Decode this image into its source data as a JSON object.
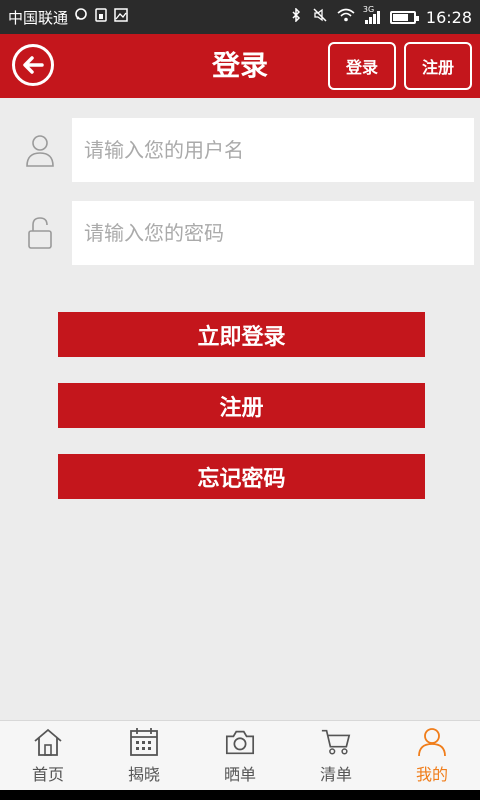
{
  "status_bar": {
    "carrier": "中国联通",
    "network_type": "3G",
    "time": "16:28",
    "battery_level": 0.75
  },
  "header": {
    "title": "登录",
    "login_label": "登录",
    "register_label": "注册"
  },
  "form": {
    "username_placeholder": "请输入您的用户名",
    "password_placeholder": "请输入您的密码"
  },
  "actions": {
    "login_now": "立即登录",
    "register": "注册",
    "forgot_password": "忘记密码"
  },
  "nav": {
    "items": [
      {
        "label": "首页",
        "icon": "home-icon"
      },
      {
        "label": "揭晓",
        "icon": "calendar-icon"
      },
      {
        "label": "晒单",
        "icon": "camera-icon"
      },
      {
        "label": "清单",
        "icon": "cart-icon"
      },
      {
        "label": "我的",
        "icon": "user-icon"
      }
    ],
    "active_index": 4
  },
  "colors": {
    "brand_red": "#c4161c",
    "active_orange": "#f07d1a",
    "background": "#ececec"
  }
}
